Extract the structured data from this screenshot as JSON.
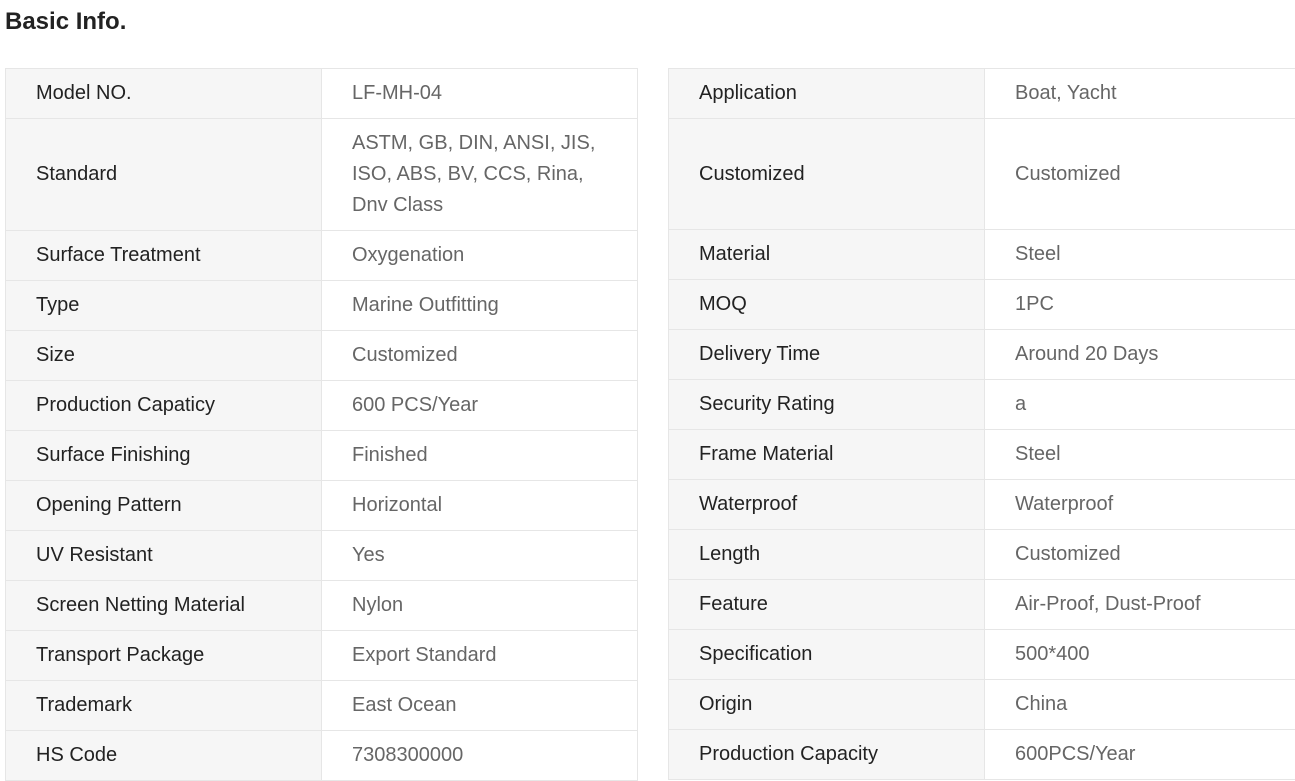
{
  "section": {
    "title": "Basic Info."
  },
  "left_table": [
    {
      "label": "Model NO.",
      "value": "LF-MH-04"
    },
    {
      "label": "Standard",
      "value": "ASTM, GB, DIN, ANSI, JIS, ISO, ABS, BV, CCS, Rina, Dnv Class"
    },
    {
      "label": "Surface Treatment",
      "value": "Oxygenation"
    },
    {
      "label": "Type",
      "value": "Marine Outfitting"
    },
    {
      "label": "Size",
      "value": "Customized"
    },
    {
      "label": "Production Capaticy",
      "value": "600 PCS/Year"
    },
    {
      "label": "Surface Finishing",
      "value": "Finished"
    },
    {
      "label": "Opening Pattern",
      "value": "Horizontal"
    },
    {
      "label": "UV Resistant",
      "value": "Yes"
    },
    {
      "label": "Screen Netting Material",
      "value": "Nylon"
    },
    {
      "label": "Transport Package",
      "value": "Export Standard"
    },
    {
      "label": "Trademark",
      "value": "East Ocean"
    },
    {
      "label": "HS Code",
      "value": "7308300000"
    }
  ],
  "right_table": [
    {
      "label": "Application",
      "value": "Boat, Yacht"
    },
    {
      "label": "Customized",
      "value": "Customized"
    },
    {
      "label": "Material",
      "value": "Steel"
    },
    {
      "label": "MOQ",
      "value": "1PC"
    },
    {
      "label": "Delivery Time",
      "value": "Around 20 Days"
    },
    {
      "label": "Security Rating",
      "value": "a"
    },
    {
      "label": "Frame Material",
      "value": "Steel"
    },
    {
      "label": "Waterproof",
      "value": "Waterproof"
    },
    {
      "label": "Length",
      "value": "Customized"
    },
    {
      "label": "Feature",
      "value": "Air-Proof, Dust-Proof"
    },
    {
      "label": "Specification",
      "value": "500*400"
    },
    {
      "label": "Origin",
      "value": "China"
    },
    {
      "label": "Production Capacity",
      "value": "600PCS/Year"
    }
  ]
}
